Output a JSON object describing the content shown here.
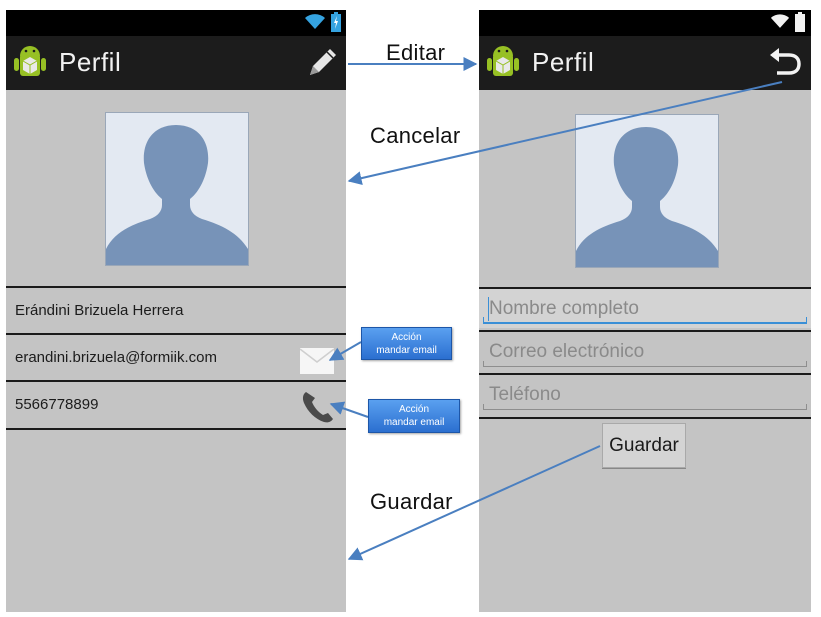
{
  "app": {
    "title": "Perfil"
  },
  "left_screen": {
    "contact": {
      "name": "Erándini Brizuela Herrera",
      "email": "erandini.brizuela@formiik.com",
      "phone": "5566778899"
    }
  },
  "right_screen": {
    "fields": {
      "name_placeholder": "Nombre completo",
      "email_placeholder": "Correo electrónico",
      "phone_placeholder": "Teléfono"
    },
    "save_button": "Guardar"
  },
  "annotations": {
    "edit": "Editar",
    "cancel": "Cancelar",
    "save": "Guardar",
    "callout_email_line1": "Acción",
    "callout_email_line2": "mandar email",
    "callout_phone_line1": "Acción",
    "callout_phone_line2": "mandar email"
  },
  "colors": {
    "screen_background": "#c4c4c4",
    "action_bar": "#1c1c1c",
    "accent": "#3a8fd6",
    "arrow": "#4a7fc0",
    "avatar_silhouette": "#7793b8",
    "android_green": "#97c024"
  },
  "icons": {
    "status_wifi": "wifi-icon",
    "status_battery": "battery-icon",
    "app": "android-app-icon",
    "edit": "pencil-icon",
    "back": "undo-icon",
    "email": "envelope-icon",
    "phone": "phone-handset-icon"
  }
}
